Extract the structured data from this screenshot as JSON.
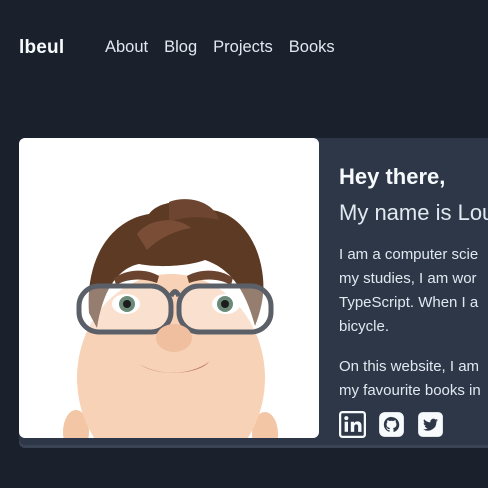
{
  "header": {
    "brand": "lbeul",
    "nav": [
      {
        "label": "About"
      },
      {
        "label": "Blog"
      },
      {
        "label": "Projects"
      },
      {
        "label": "Books"
      }
    ]
  },
  "hero": {
    "greeting": "Hey there,",
    "name_line": "My name is Lou",
    "bio_lines": [
      "I am a computer scie",
      "my studies, I am wor",
      "TypeScript. When I a",
      "bicycle."
    ],
    "site_lines": [
      "On this website, I am",
      "my favourite books in"
    ],
    "avatar": {
      "icon": "memoji-avatar"
    }
  },
  "socials": [
    {
      "icon": "linkedin-icon"
    },
    {
      "icon": "github-icon"
    },
    {
      "icon": "twitter-icon"
    }
  ],
  "colors": {
    "background": "#1a202c",
    "card": "#2d3748",
    "text": "#f7fafc"
  }
}
